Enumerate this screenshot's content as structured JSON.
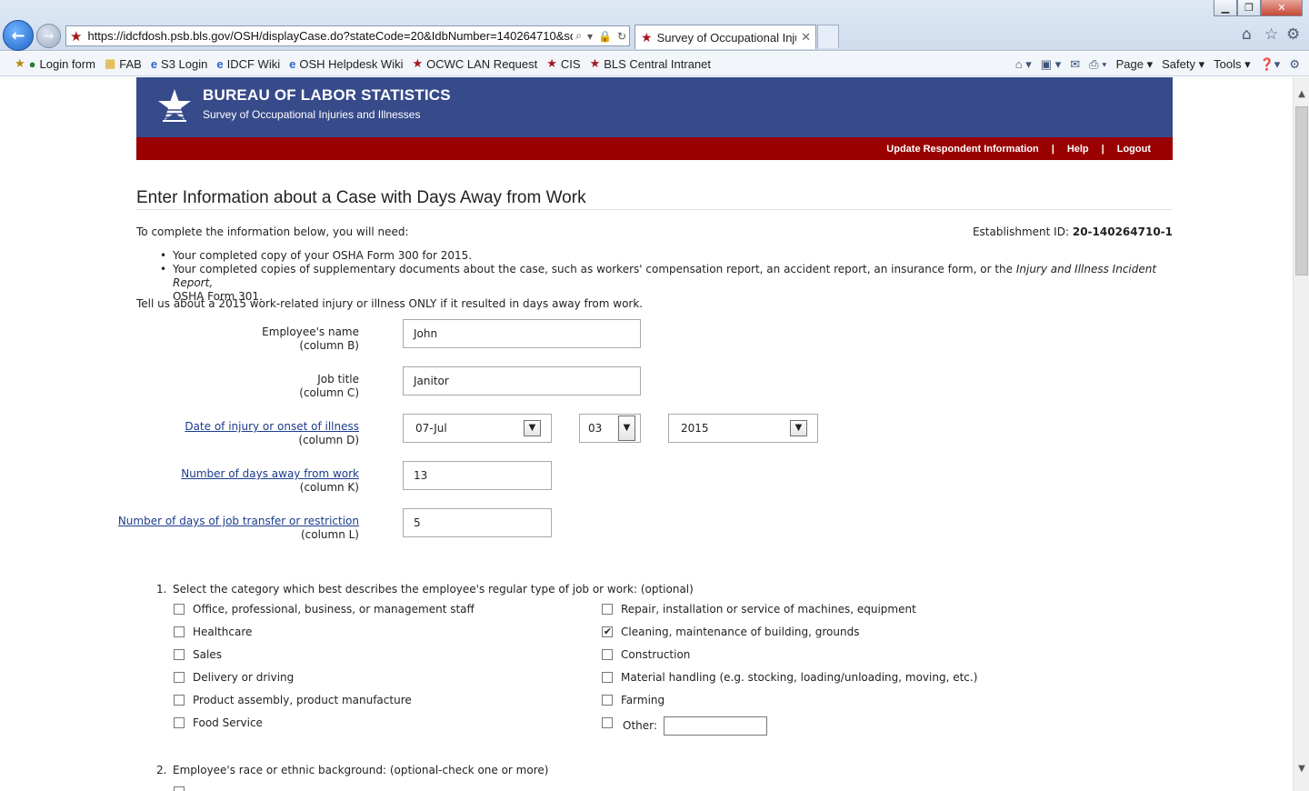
{
  "browser": {
    "url": "https://idcfdosh.psb.bls.gov/OSH/displayCase.do?stateCode=20&IdbNumber=140264710&solicitati",
    "tab_title": "Survey of Occupational Inju...",
    "favorites": [
      "Login form",
      "FAB",
      "S3 Login",
      "IDCF Wiki",
      "OSH Helpdesk Wiki",
      "OCWC LAN Request",
      "CIS",
      "BLS Central Intranet"
    ],
    "commands": [
      "Page",
      "Safety",
      "Tools"
    ]
  },
  "header": {
    "title": "BUREAU OF LABOR STATISTICS",
    "subtitle": "Survey of Occupational Injuries and Illnesses",
    "nav": [
      "Update Respondent Information",
      "Help",
      "Logout"
    ],
    "separator": "|"
  },
  "page": {
    "title": "Enter Information about a Case with Days Away from Work",
    "intro": "To complete the information below, you will need:",
    "establishment_label": "Establishment ID:",
    "establishment_id": "20-140264710-1",
    "bullets": {
      "b1": "Your completed copy of your OSHA Form 300 for 2015.",
      "b2_a": "Your completed copies of supplementary documents about the case, such as workers' compensation report, an accident report, an insurance form, or the ",
      "b2_italic": "Injury and Illness Incident Report,",
      "b2_b": "OSHA Form 301."
    },
    "tell_us": "Tell us about a 2015 work-related injury or illness ONLY if it resulted in days away from work."
  },
  "form": {
    "employee_name": {
      "label": "Employee's name",
      "col": "(column B)",
      "value": "John"
    },
    "job_title": {
      "label": "Job title",
      "col": "(column C)",
      "value": "Janitor"
    },
    "date": {
      "label": "Date of injury or onset of illness",
      "col": "(column D)",
      "month": "07-Jul",
      "day": "03",
      "year": "2015"
    },
    "days_away": {
      "label": "Number of days away from work",
      "col": "(column K)",
      "value": "13"
    },
    "days_transfer": {
      "label": "Number of days of job transfer or restriction",
      "col": "(column L)",
      "value": "5"
    }
  },
  "q1": {
    "number": "1.",
    "text": "Select the category which best describes the employee's regular type of job or work: (optional)",
    "left": [
      {
        "label": "Office, professional, business, or management staff",
        "checked": false
      },
      {
        "label": "Healthcare",
        "checked": false
      },
      {
        "label": "Sales",
        "checked": false
      },
      {
        "label": "Delivery or driving",
        "checked": false
      },
      {
        "label": "Product assembly, product manufacture",
        "checked": false
      },
      {
        "label": "Food Service",
        "checked": false
      }
    ],
    "right": [
      {
        "label": "Repair, installation or service of machines, equipment",
        "checked": false
      },
      {
        "label": "Cleaning, maintenance of building, grounds",
        "checked": true
      },
      {
        "label": "Construction",
        "checked": false
      },
      {
        "label": "Material handling (e.g. stocking, loading/unloading, moving, etc.)",
        "checked": false
      },
      {
        "label": "Farming",
        "checked": false
      },
      {
        "label": "Other:",
        "checked": false
      }
    ],
    "other_value": ""
  },
  "q2": {
    "number": "2.",
    "text": "Employee's race or ethnic background: (optional-check one or more)"
  }
}
